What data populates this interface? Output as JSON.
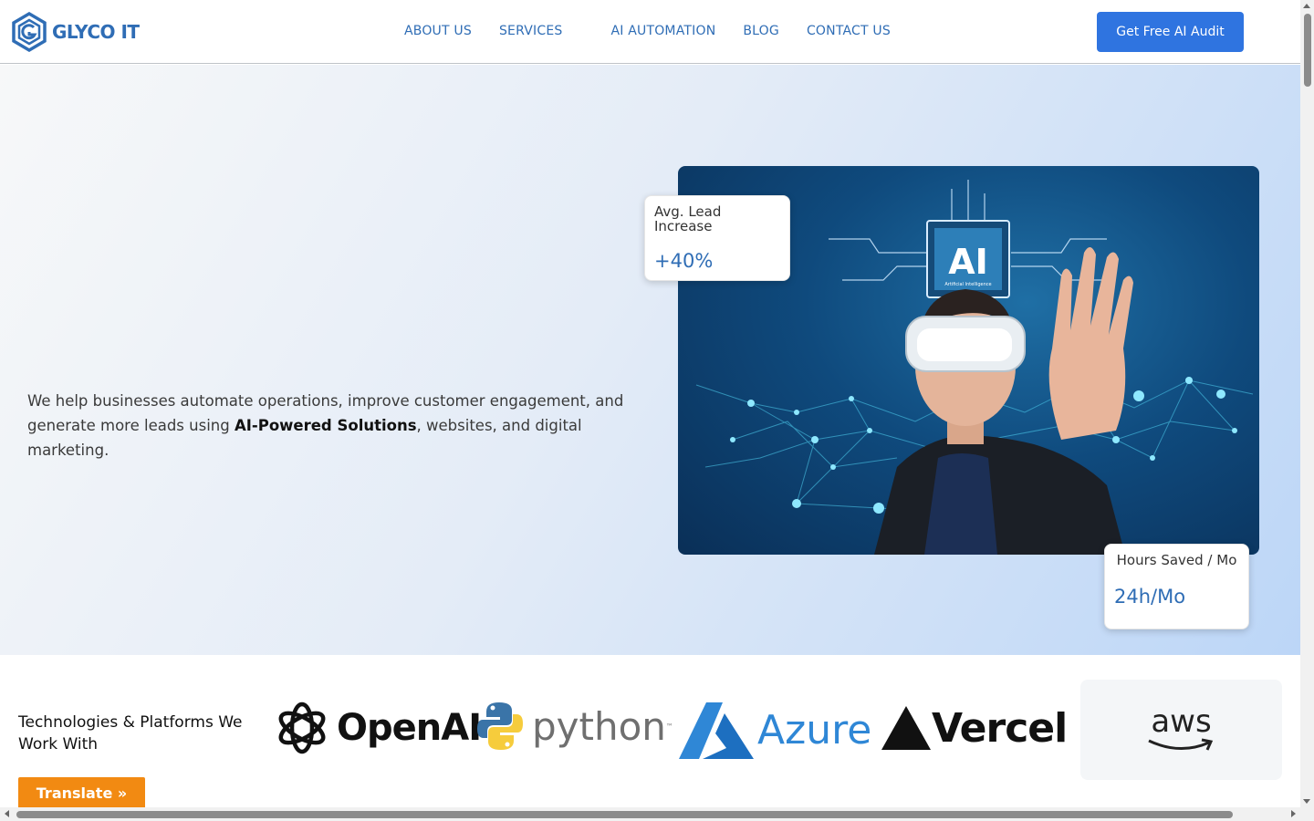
{
  "header": {
    "logo_text": "GLYCO IT",
    "nav": [
      "ABOUT US",
      "SERVICES",
      "AI AUTOMATION",
      "BLOG",
      "CONTACT US"
    ],
    "cta_label": "Get Free AI Audit"
  },
  "hero": {
    "text_before": "We help businesses automate operations, improve customer engagement, and generate more leads using ",
    "text_bold": "AI-Powered Solutions",
    "text_after": ", websites, and digital marketing.",
    "image_chip_text": "AI",
    "image_chip_subtext": "Artificial Intelligence",
    "stats": [
      {
        "label": "Avg. Lead Increase",
        "value": "+40%"
      },
      {
        "label": "Hours Saved / Mo",
        "value": "24h/Mo"
      }
    ]
  },
  "technologies": {
    "title": "Technologies & Platforms We Work With",
    "logos": [
      "OpenAI",
      "python",
      "Azure",
      "Vercel",
      "aws"
    ],
    "python_tm": "™"
  },
  "translate_label": "Translate »",
  "colors": {
    "accent": "#2f74e0",
    "nav": "#2f6db5",
    "translate": "#f28a12"
  }
}
